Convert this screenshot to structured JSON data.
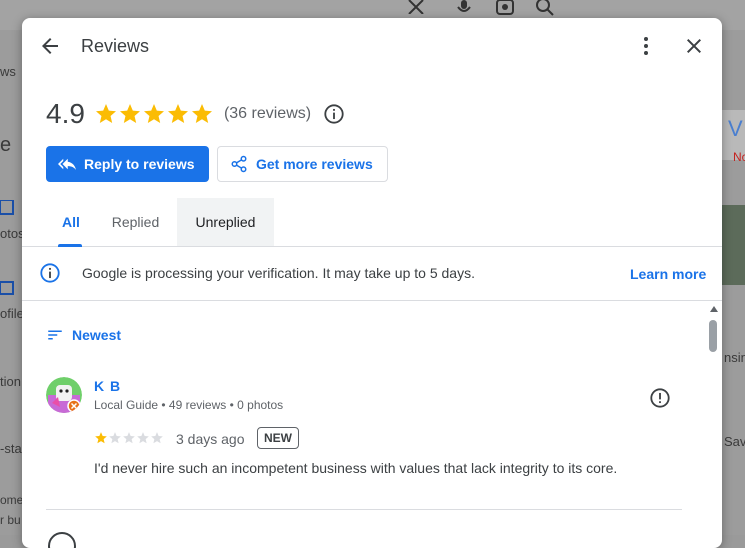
{
  "background": {
    "fragments": [
      "ws",
      "e",
      "otos",
      "ofile",
      "tion.",
      "-sta",
      "ome",
      "r bu",
      "nsin",
      "Save",
      "Nc",
      "V"
    ]
  },
  "header": {
    "title": "Reviews",
    "back_icon": "arrow-back-icon",
    "more_icon": "more-vert-icon",
    "close_icon": "close-icon"
  },
  "summary": {
    "rating": "4.9",
    "stars": 5,
    "review_count": "(36 reviews)"
  },
  "actions": {
    "reply": "Reply to reviews",
    "get_more": "Get more reviews"
  },
  "tabs": [
    {
      "label": "All",
      "active": true
    },
    {
      "label": "Replied",
      "active": false
    },
    {
      "label": "Unreplied",
      "active": false
    }
  ],
  "notice": {
    "text": "Google is processing your verification. It may take up to 5 days.",
    "link": "Learn more"
  },
  "sort": {
    "label": "Newest"
  },
  "reviews": [
    {
      "name": "K B",
      "meta": "Local Guide • 49 reviews • 0 photos",
      "rating": 1,
      "max_rating": 5,
      "date": "3 days ago",
      "badge": "NEW",
      "text": "I'd never hire such an incompetent business with values that lack integrity to its core."
    }
  ],
  "colors": {
    "accent": "#1a73e8",
    "star": "#fbbc04",
    "star_empty": "#dadce0"
  }
}
